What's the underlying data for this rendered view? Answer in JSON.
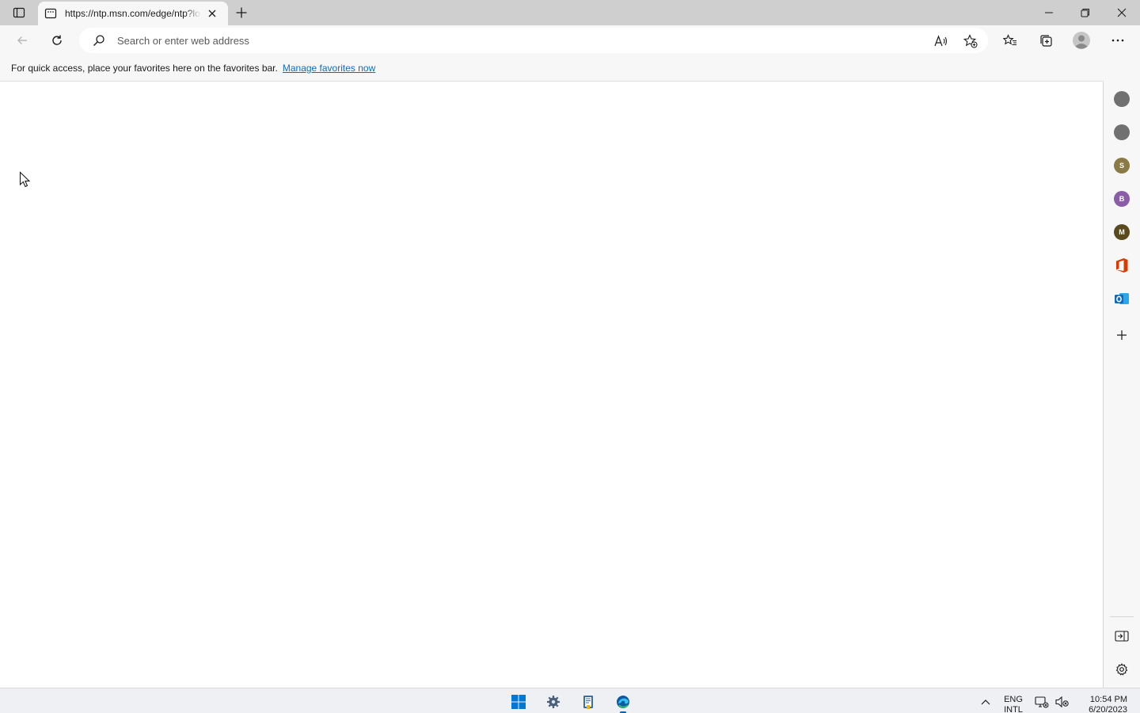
{
  "browser": {
    "tab": {
      "title": "https://ntp.msn.com/edge/ntp?locale=en-US"
    },
    "address_bar": {
      "placeholder": "Search or enter web address",
      "value": ""
    },
    "favorites_bar": {
      "message": "For quick access, place your favorites here on the favorites bar.",
      "link": "Manage favorites now"
    },
    "icons": {
      "tab_actions": "tab-actions-icon",
      "favicon": "page-icon",
      "close_tab": "close-icon",
      "new_tab": "plus-icon",
      "minimize": "minimize-icon",
      "restore": "restore-icon",
      "close_window": "close-icon",
      "back": "back-arrow-icon",
      "refresh": "refresh-icon",
      "search": "search-icon",
      "read_aloud": "read-aloud-icon",
      "add_favorite": "star-plus-icon",
      "favorites": "favorites-icon",
      "collections": "collections-icon",
      "profile": "profile-avatar-icon",
      "more": "more-icon"
    }
  },
  "sidebar": {
    "items": [
      {
        "name": "sidebar-app-1",
        "letter": "",
        "color": "#707070"
      },
      {
        "name": "sidebar-app-2",
        "letter": "",
        "color": "#707070"
      },
      {
        "name": "sidebar-app-s",
        "letter": "S",
        "color": "#8a7a45"
      },
      {
        "name": "sidebar-app-b",
        "letter": "B",
        "color": "#8b5ca8"
      },
      {
        "name": "sidebar-app-m",
        "letter": "M",
        "color": "#5a4a1e"
      }
    ],
    "office_color": "#d83b01",
    "outlook_color": "#0f6cbd"
  },
  "taskbar": {
    "apps": [
      "start-icon",
      "settings-icon",
      "file-explorer-icon",
      "edge-icon"
    ],
    "language": {
      "line1": "ENG",
      "line2": "INTL"
    },
    "time": "10:54 PM",
    "date": "6/20/2023",
    "accent": "#0067c0"
  }
}
